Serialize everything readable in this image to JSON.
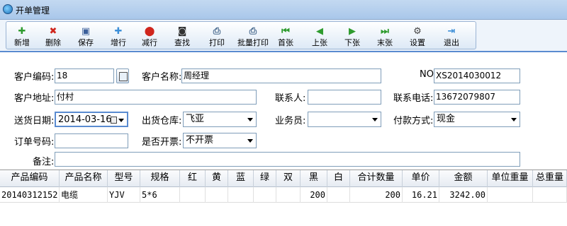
{
  "window": {
    "title": "开单管理"
  },
  "toolbar": [
    {
      "label": "新增",
      "icon": "plus-icon",
      "glyph": "✚",
      "color": "#2e9b2e"
    },
    {
      "label": "删除",
      "icon": "delete-icon",
      "glyph": "✖",
      "color": "#d0261d"
    },
    {
      "label": "保存",
      "icon": "save-icon",
      "glyph": "▣",
      "color": "#3b5f9a"
    },
    {
      "label": "增行",
      "icon": "add-row-icon",
      "glyph": "✚",
      "color": "#3d8fd8"
    },
    {
      "label": "减行",
      "icon": "remove-row-icon",
      "glyph": "⬤",
      "color": "#d0261d"
    },
    {
      "label": "查找",
      "icon": "binoculars-icon",
      "glyph": "◙",
      "color": "#333333"
    },
    {
      "label": "打印",
      "icon": "print-icon",
      "glyph": "⎙",
      "color": "#4a6b8f"
    },
    {
      "label": "批量打印",
      "icon": "batch-print-icon",
      "glyph": "⎙",
      "color": "#4a6b8f"
    },
    {
      "label": "首张",
      "icon": "first-icon",
      "glyph": "⏮",
      "color": "#2e9b2e"
    },
    {
      "label": "上张",
      "icon": "previous-icon",
      "glyph": "◀",
      "color": "#2e9b2e"
    },
    {
      "label": "下张",
      "icon": "next-icon",
      "glyph": "▶",
      "color": "#2e9b2e"
    },
    {
      "label": "末张",
      "icon": "last-icon",
      "glyph": "⏭",
      "color": "#2e9b2e"
    },
    {
      "label": "设置",
      "icon": "settings-icon",
      "glyph": "⚙",
      "color": "#444444"
    },
    {
      "label": "退出",
      "icon": "exit-icon",
      "glyph": "⇥",
      "color": "#3d8fd8"
    }
  ],
  "form": {
    "customer_code_label": "客户编码:",
    "customer_code": "18",
    "customer_name_label": "客户名称:",
    "customer_name": "周经理",
    "no_label": "NO:",
    "no": "XS2014030012",
    "address_label": "客户地址:",
    "address": "付村",
    "contact_label": "联系人:",
    "contact": "",
    "phone_label": "联系电话:",
    "phone": "13672079807",
    "delivery_date_label": "送货日期:",
    "delivery_date": "2014-03-16",
    "warehouse_label": "出货仓库:",
    "warehouse": "飞亚",
    "salesman_label": "业务员:",
    "salesman": "",
    "payment_label": "付款方式:",
    "payment": "现金",
    "order_no_label": "订单号码:",
    "order_no": "",
    "invoice_label": "是否开票:",
    "invoice": "不开票",
    "remark_label": "备注:",
    "remark": ""
  },
  "grid": {
    "columns": [
      "产品编码",
      "产品名称",
      "型号",
      "规格",
      "红",
      "黄",
      "蓝",
      "绿",
      "双",
      "黑",
      "白",
      "合计数量",
      "单价",
      "金额",
      "单位重量",
      "总重量"
    ],
    "rows": [
      {
        "code": "20140312152",
        "name": "电缆",
        "model": "YJV",
        "spec": "5*6",
        "black": "200",
        "total_qty": "200",
        "price": "16.21",
        "amount": "3242.00"
      }
    ]
  },
  "colors": {
    "accent": "#5a8bd0",
    "title_bar": "#a9c7ea"
  }
}
